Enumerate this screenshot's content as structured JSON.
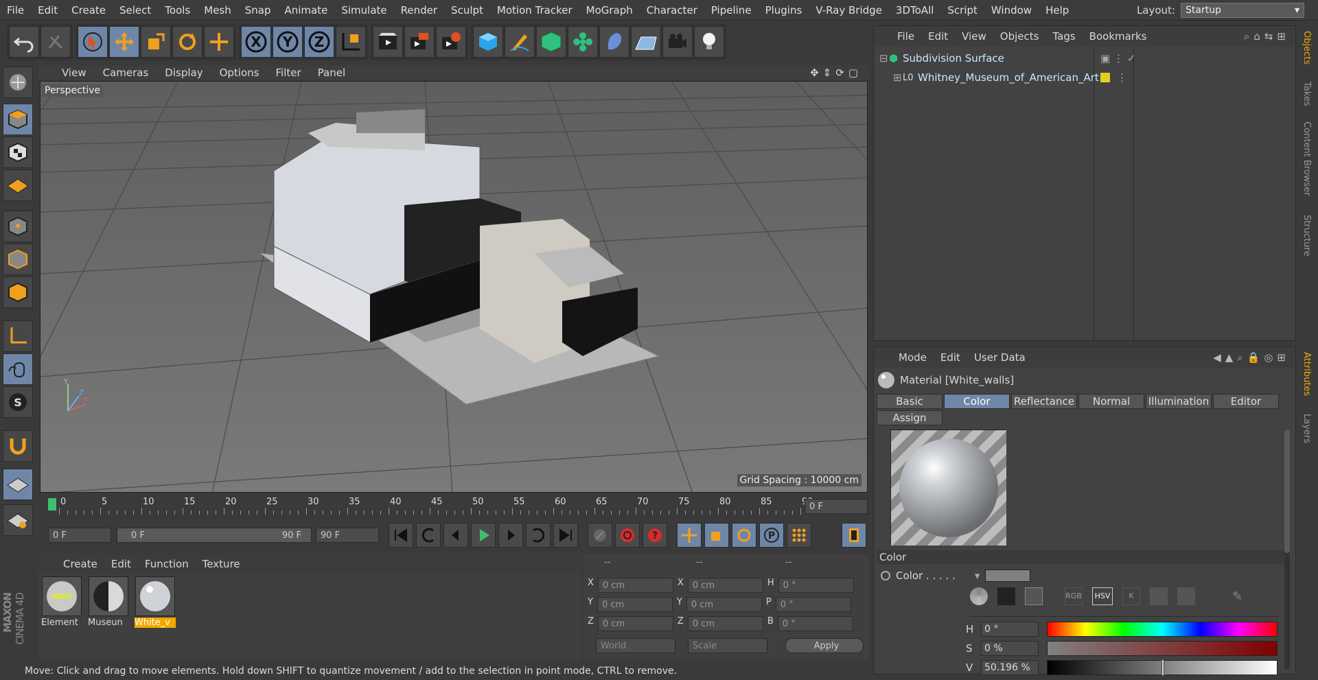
{
  "menu": [
    "File",
    "Edit",
    "Create",
    "Select",
    "Tools",
    "Mesh",
    "Snap",
    "Animate",
    "Simulate",
    "Render",
    "Sculpt",
    "Motion Tracker",
    "MoGraph",
    "Character",
    "Pipeline",
    "Plugins",
    "V-Ray Bridge",
    "3DToAll",
    "Script",
    "Window",
    "Help"
  ],
  "layout": {
    "label": "Layout:",
    "value": "Startup"
  },
  "toolbar_icons": [
    "undo-icon",
    "redo-icon",
    "select-arrow-icon",
    "move-icon",
    "scale-icon",
    "rotate-icon",
    "live-selection-icon",
    "x-axis-icon",
    "y-axis-icon",
    "z-axis-icon",
    "coordinate-system-icon",
    "render-view-icon",
    "render-picture-viewer-icon",
    "render-settings-icon",
    "cube-icon",
    "pen-icon",
    "subdivision-icon",
    "cloner-icon",
    "deformer-icon",
    "floor-icon",
    "camera-icon",
    "light-icon"
  ],
  "viewport": {
    "menu": [
      "View",
      "Cameras",
      "Display",
      "Options",
      "Filter",
      "Panel"
    ],
    "label": "Perspective",
    "grid_spacing": "Grid Spacing : 10000 cm"
  },
  "timeline": {
    "ticks": [
      "0",
      "5",
      "10",
      "15",
      "20",
      "25",
      "30",
      "35",
      "40",
      "45",
      "50",
      "55",
      "60",
      "65",
      "70",
      "75",
      "80",
      "85",
      "90"
    ],
    "current_frame": "0 F",
    "start": "0 F",
    "range_start": "0 F",
    "range_end": "90 F",
    "end": "90 F"
  },
  "material_manager": {
    "menu": [
      "Create",
      "Edit",
      "Function",
      "Texture"
    ],
    "materials": [
      {
        "name": "Element",
        "selected": false
      },
      {
        "name": "Museun",
        "selected": false
      },
      {
        "name": "White_v",
        "selected": true
      }
    ]
  },
  "coordinates": {
    "headers": [
      "--",
      "--",
      "--"
    ],
    "rows": [
      {
        "a": "X",
        "av": "0 cm",
        "b": "X",
        "bv": "0 cm",
        "c": "H",
        "cv": "0 °"
      },
      {
        "a": "Y",
        "av": "0 cm",
        "b": "Y",
        "bv": "0 cm",
        "c": "P",
        "cv": "0 °"
      },
      {
        "a": "Z",
        "av": "0 cm",
        "b": "Z",
        "bv": "0 cm",
        "c": "B",
        "cv": "0 °"
      }
    ],
    "world": "World",
    "scale": "Scale",
    "apply": "Apply"
  },
  "object_manager": {
    "menu": [
      "File",
      "Edit",
      "View",
      "Objects",
      "Tags",
      "Bookmarks"
    ],
    "objects": [
      {
        "name": "Subdivision Surface"
      },
      {
        "name": "Whitney_Museum_of_American_Art"
      }
    ]
  },
  "attribute_manager": {
    "menu": [
      "Mode",
      "Edit",
      "User Data"
    ],
    "title": "Material [White_walls]",
    "tabs": [
      "Basic",
      "Color",
      "Reflectance",
      "Normal",
      "Illumination",
      "Editor",
      "Assign"
    ],
    "active_tab": "Color",
    "section": "Color",
    "color_label": "Color . . . . .",
    "h": {
      "label": "H",
      "value": "0 °"
    },
    "s": {
      "label": "S",
      "value": "0 %"
    },
    "v": {
      "label": "V",
      "value": "50.196 %",
      "level": 0.502
    },
    "mode_buttons": [
      "RGB",
      "HSV",
      "K"
    ]
  },
  "right_tabs": [
    "Objects",
    "Takes",
    "Content Browser",
    "Structure",
    "Attributes",
    "Layers"
  ],
  "status": "Move: Click and drag to move elements. Hold down SHIFT to quantize movement / add to the selection in point mode, CTRL to remove.",
  "logo": {
    "brand": "MAXON",
    "product": "CINEMA 4D"
  }
}
